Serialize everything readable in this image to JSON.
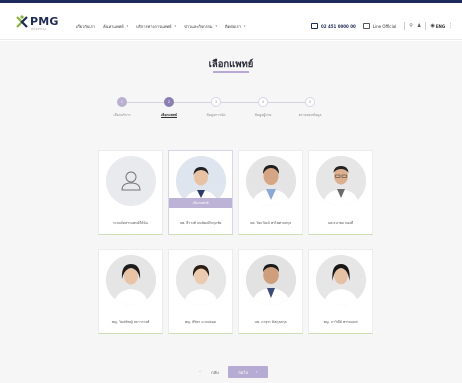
{
  "header": {
    "logo_text": "PMG",
    "logo_sub": "HOSPITAL",
    "nav": [
      {
        "label": "เกี่ยวกับเรา",
        "chevron": false
      },
      {
        "label": "ค้นหาแพทย์",
        "chevron": true
      },
      {
        "label": "บริการทางการแพทย์",
        "chevron": true
      },
      {
        "label": "ข่าวและกิจกรรม",
        "chevron": true
      },
      {
        "label": "ติดต่อเรา",
        "chevron": true
      }
    ],
    "phone": "02 451 0000 00",
    "line_label": "Line Official",
    "lang": "ENG"
  },
  "page": {
    "title": "เลือกแพทย์"
  },
  "steps": [
    {
      "number": "1",
      "label": "เลือกบริการ",
      "state": "done"
    },
    {
      "number": "2",
      "label": "เลือกแพทย์",
      "state": "active"
    },
    {
      "number": "3",
      "label": "ข้อมูลการนัด",
      "state": "todo"
    },
    {
      "number": "4",
      "label": "ข้อมูลผู้ป่วย",
      "state": "todo"
    },
    {
      "number": "5",
      "label": "ตรวจสอบข้อมูล",
      "state": "todo"
    }
  ],
  "doctors": [
    {
      "name": "ระบบจัดสรรแพทย์ให้ฉัน",
      "photo": "placeholder",
      "selected": false
    },
    {
      "name": "นพ. ธีรวงศ์ ธนพัฒน์กิจกุลชัย",
      "photo": "male-1",
      "selected": true
    },
    {
      "name": "นพ. ปิยะวัฒน์ พรไพศาลสกุล",
      "photo": "male-2",
      "selected": false
    },
    {
      "name": "นพ.ธนาพล ทองดี",
      "photo": "male-3",
      "selected": false
    },
    {
      "name": "พญ. วิมลพิชญ์ สถาวรวงศ์",
      "photo": "female-1",
      "selected": false
    },
    {
      "name": "พญ. ศิริพร นวลปลอด",
      "photo": "female-2",
      "selected": false
    },
    {
      "name": "นพ. ภาสุระ ดิสกุลสกุล",
      "photo": "male-4",
      "selected": false
    },
    {
      "name": "พญ. ภาวิณีย์ พรรณเมศ",
      "photo": "female-3",
      "selected": false
    }
  ],
  "selected_badge": "เลือกแพทย์",
  "pager": {
    "back_label": "กลับ",
    "next_label": "ถัดไป"
  },
  "colors": {
    "brand_navy": "#1e2a5a",
    "accent_purple": "#8a7fb0",
    "accent_light_purple": "#b6acd3",
    "card_underline": "#cfe0b9"
  },
  "icons": {
    "phone": "phone-icon",
    "line": "line-icon",
    "search": "search-icon",
    "user": "user-icon",
    "globe": "globe-icon",
    "more": "more-icon"
  }
}
